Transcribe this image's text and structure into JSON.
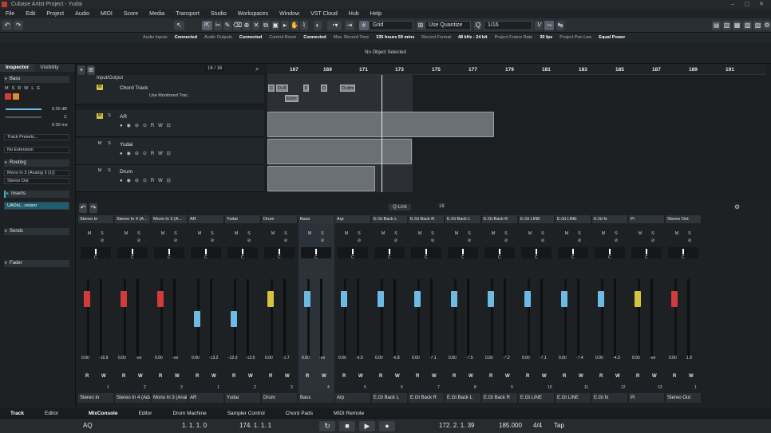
{
  "window": {
    "title": "Cubase Artist Project - Yudai",
    "controls": [
      "–",
      "▢",
      "✕"
    ]
  },
  "menu": [
    "File",
    "Edit",
    "Project",
    "Audio",
    "MIDI",
    "Score",
    "Media",
    "Transport",
    "Studio",
    "Workspaces",
    "Window",
    "VST Cloud",
    "Hub",
    "Help"
  ],
  "toolbar": {
    "snap_type": "Grid",
    "quantize_mode": "Use Quantize",
    "quantize_value": "1/16"
  },
  "status": {
    "audio_inputs": "Audio Inputs",
    "audio_inputs_state": "Connected",
    "audio_outputs": "Audio Outputs",
    "audio_outputs_state": "Connected",
    "control_room": "Control Room",
    "control_room_state": "Connected",
    "max_record_label": "Max. Record Time",
    "max_record": "335 hours 59 mins",
    "record_format_label": "Record Format",
    "record_format": "48 kHz - 24 bit",
    "frame_rate_label": "Project Frame Rate",
    "frame_rate": "30 fps",
    "pan_law_label": "Project Pan Law",
    "pan_law": "Equal Power"
  },
  "info_line": "No Object Selected",
  "inspector": {
    "tab_inspector": "Inspector",
    "tab_visibility": "Visibility",
    "track": "Bass",
    "volume": "0.00 dB",
    "pan": "C",
    "delay": "0.00 ms",
    "presets": "Track Presets...",
    "extension": "No Extension",
    "routing": "Routing",
    "input": "Mono In 3 (Analog 3 (1))",
    "output": "Stereo Out",
    "inserts": "Inserts",
    "insert1": "UADxL...ressor",
    "sends": "Sends",
    "fader": "Fader"
  },
  "track_list": {
    "zoom": "16 / 16",
    "folder": "Input/Output",
    "tracks": [
      {
        "name": "Chord Track",
        "sub": "Use Monitored Trac."
      },
      {
        "name": "AR"
      },
      {
        "name": "Yudai"
      },
      {
        "name": "Drum"
      }
    ]
  },
  "ruler": [
    "167",
    "169",
    "171",
    "173",
    "175",
    "177",
    "179",
    "181",
    "183",
    "185",
    "187",
    "189",
    "191"
  ],
  "chords": [
    "C",
    "D♭/F",
    "F",
    "D",
    "D",
    "D♭dim",
    "X",
    "Emin"
  ],
  "mixer": {
    "qlink": "Q-Link",
    "bank": "18",
    "channels": [
      {
        "name": "Stereo In",
        "vol": "0.00",
        "peak": "-16.9",
        "bottom": "Stereo In",
        "color": "#d23b3b",
        "num": "1"
      },
      {
        "name": "Stereo In 4 (A...",
        "vol": "0.00",
        "peak": "-oo",
        "bottom": "Stereo In 4 (Adat 3 (1) / 4 (1))",
        "color": "#d23b3b",
        "num": "2"
      },
      {
        "name": "Mono In 3 (A...",
        "vol": "0.00",
        "peak": "-oo",
        "bottom": "Mono In 3 (Analog 3 (1))",
        "color": "#d23b3b",
        "num": "3"
      },
      {
        "name": "AR",
        "vol": "0.00",
        "peak": "-13.2",
        "bottom": "AR",
        "color": "#6bbbe4",
        "num": "1"
      },
      {
        "name": "Yudai",
        "vol": "-12.0",
        "peak": "-12.0",
        "bottom": "Yudai",
        "color": "#6bbbe4",
        "num": "2"
      },
      {
        "name": "Drum",
        "vol": "0.00",
        "peak": "-1.7",
        "bottom": "Drum",
        "color": "#d5c43e",
        "num": "3"
      },
      {
        "name": "Bass",
        "vol": "0.00",
        "peak": "-oo",
        "bottom": "Bass",
        "color": "#6bbbe4",
        "num": "4"
      },
      {
        "name": "Arp",
        "vol": "0.00",
        "peak": "-6.9",
        "bottom": "Arp",
        "color": "#6bbbe4",
        "num": "5"
      },
      {
        "name": "E.Gt Back L",
        "vol": "0.00",
        "peak": "-6.8",
        "bottom": "E.Gt Back L",
        "color": "#6bbbe4",
        "num": "6"
      },
      {
        "name": "E.Gt Back R",
        "vol": "0.00",
        "peak": "-7.1",
        "bottom": "E.Gt Back R",
        "color": "#6bbbe4",
        "num": "7"
      },
      {
        "name": "E.Gt Back L",
        "vol": "0.00",
        "peak": "-7.5",
        "bottom": "E.Gt Back L",
        "color": "#6bbbe4",
        "num": "8"
      },
      {
        "name": "E.Gt Back R",
        "vol": "0.00",
        "peak": "-7.2",
        "bottom": "E.Gt Back R",
        "color": "#6bbbe4",
        "num": "9"
      },
      {
        "name": "E.Gt LINE",
        "vol": "0.00",
        "peak": "-7.1",
        "bottom": "E.Gt LINE",
        "color": "#6bbbe4",
        "num": "10"
      },
      {
        "name": "E.Gt LINE",
        "vol": "0.00",
        "peak": "-7.4",
        "bottom": "E.Gt LINE",
        "color": "#6bbbe4",
        "num": "11"
      },
      {
        "name": "E.Gt fx",
        "vol": "0.00",
        "peak": "-4.3",
        "bottom": "E.Gt fx",
        "color": "#6bbbe4",
        "num": "12"
      },
      {
        "name": "Pi",
        "vol": "0.00",
        "peak": "-oo",
        "bottom": "Pi",
        "color": "#d5c43e",
        "num": "13"
      },
      {
        "name": "Stereo Out",
        "vol": "0.00",
        "peak": "1.9",
        "bottom": "Stereo Out",
        "color": "#d23b3b",
        "num": "1"
      }
    ]
  },
  "lower_tabs": [
    "Track",
    "Editor",
    "MixConsole",
    "Editor",
    "Drum Machine",
    "Sampler Control",
    "Chord Pads",
    "MIDI Remote"
  ],
  "transport": {
    "left_locator": "1. 1. 1. 0",
    "right_locator": "174. 1. 1. 1",
    "position": "172. 2. 1. 39",
    "tempo": "185.000",
    "signature": "4/4",
    "tap": "Tap",
    "aq": "AQ"
  }
}
